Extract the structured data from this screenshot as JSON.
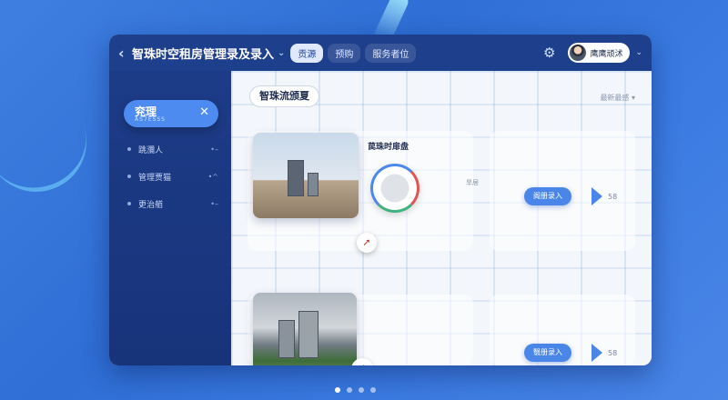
{
  "header": {
    "title": "智珠时空租房管理录及录入",
    "tabs": [
      {
        "label": "贡源",
        "active": true
      },
      {
        "label": "预购",
        "active": false
      },
      {
        "label": "服务者位",
        "active": false
      }
    ],
    "user_name": "鹰鹰顽沭"
  },
  "sidebar": {
    "active_item": {
      "label": "兖理",
      "sub": "AS7ESSS"
    },
    "items": [
      {
        "label": "跳瀰人",
        "more": "•–"
      },
      {
        "label": "管理贾猫",
        "more": "•^"
      },
      {
        "label": "更治艏",
        "more": "•–"
      }
    ]
  },
  "main": {
    "section_title": "智珠流颁夏",
    "sort_label": "最新最感 ▾",
    "cards": [
      {
        "name": "苠珠时扉盘",
        "action_label": "阁册录入",
        "count": "58",
        "map_label": "旱居"
      },
      {
        "name": "",
        "action_label": "翳册录入",
        "count": "58",
        "map_label": ""
      }
    ]
  },
  "pager": {
    "total": 4,
    "active_index": 0
  }
}
